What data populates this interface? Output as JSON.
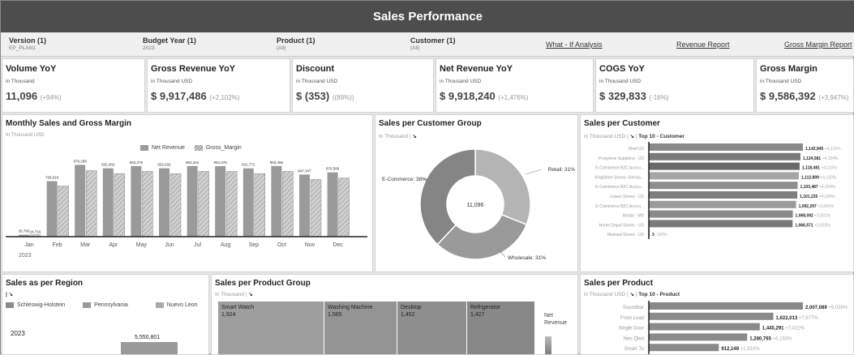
{
  "header": {
    "title": "Sales Performance"
  },
  "filters": [
    {
      "label": "Version (1)",
      "value": "EP_PLAN1"
    },
    {
      "label": "Budget Year (1)",
      "value": "2023"
    },
    {
      "label": "Product (1)",
      "value": "(All)"
    },
    {
      "label": "Customer (1)",
      "value": "(All)"
    }
  ],
  "links": {
    "what_if": "What - If  Analysis",
    "revenue": "Revenue Report",
    "gross_margin": "Gross Margin Report"
  },
  "kpis": [
    {
      "title": "Volume YoY",
      "unit": "in Thousand",
      "value": "11,096",
      "change": "(+94%)"
    },
    {
      "title": "Gross Revenue YoY",
      "unit": "in Thousand USD",
      "value": "$ 9,917,486",
      "change": "(+2,102%)"
    },
    {
      "title": "Discount",
      "unit": "in Thousand USD",
      "value": "$ (353)",
      "change": "((89%))"
    },
    {
      "title": "Net Revenue YoY",
      "unit": "in Thousand USD",
      "value": "$ 9,918,240",
      "change": "(+1,476%)"
    },
    {
      "title": "COGS YoY",
      "unit": "in Thousand USD",
      "value": "$ 329,833",
      "change": "(-16%)"
    },
    {
      "title": "Gross Margin",
      "unit": "in Thousand USD",
      "value": "$ 9,586,392",
      "change": "(+3,947%)"
    }
  ],
  "monthly": {
    "title": "Monthly Sales and Gross Margin",
    "unit": "In Thousand USD",
    "legend": [
      "Net Revenue",
      "Gross_Margin"
    ],
    "year": "2023",
    "colors": {
      "net": "#9a9a9a",
      "gm": "#c8c8c8"
    }
  },
  "customer_group": {
    "title": "Sales per Customer Group",
    "unit": "In Thousand",
    "center": "11,096",
    "labels": {
      "retail": "Retail: 31%",
      "ecommerce": "E-Commerce: 38%",
      "wholesale": "Wholesale: 31%"
    }
  },
  "sales_customer": {
    "title": "Sales per Customer",
    "unit": "in Thousand USD",
    "subtitle": "Top 10 - Customer"
  },
  "region": {
    "title": "Sales as per Region",
    "legend": [
      "Schleswig-Holstein",
      "Pennsylvania",
      "Nuevo Leon"
    ],
    "year": "2023",
    "value": "5,550,801"
  },
  "product_group": {
    "title": "Sales per Product Group",
    "unit": "In Thousand",
    "cells": [
      {
        "name": "Smart Watch",
        "value": "1,924"
      },
      {
        "name": "Washing Machine",
        "value": "1,565"
      },
      {
        "name": "Desktop",
        "value": "1,452"
      },
      {
        "name": "Refrigerator",
        "value": "1,427"
      }
    ],
    "legend": "Net Revenue"
  },
  "sales_product": {
    "title": "Sales per Product",
    "unit": "in Thousand USD",
    "subtitle": "Top 10 - Product"
  },
  "chart_data": [
    {
      "type": "bar",
      "title": "Monthly Sales and Gross Margin",
      "categories": [
        "Jan",
        "Feb",
        "Mar",
        "Apr",
        "May",
        "Jun",
        "Jul",
        "Aug",
        "Sep",
        "Oct",
        "Nov",
        "Dec"
      ],
      "series": [
        {
          "name": "Net Revenue",
          "values": [
            26766,
            756616,
            979299,
            932402,
            963278,
            932632,
            963344,
            962376,
            931771,
            963496,
            847347,
            876588
          ]
        },
        {
          "name": "Gross_Margin",
          "values": [
            24716,
            690000,
            900000,
            860000,
            890000,
            860000,
            890000,
            890000,
            860000,
            890000,
            780000,
            800000
          ]
        }
      ],
      "labels": [
        "26,766",
        "756,616",
        "979,299",
        "932,402",
        "963,278",
        "932,632",
        "963,344",
        "962,376",
        "931,771",
        "963,496",
        "847,347",
        "876,588"
      ],
      "gm_first_label": "24,716",
      "ylim": [
        0,
        1050000
      ]
    },
    {
      "type": "pie",
      "title": "Sales per Customer Group",
      "categories": [
        "Retail",
        "Wholesale",
        "E-Commerce"
      ],
      "values": [
        31,
        31,
        38
      ]
    },
    {
      "type": "bar",
      "title": "Sales per Customer",
      "categories": [
        "Shell US",
        "Prepylene Suppliers · US",
        "E-Commerce B2C Accou...",
        "Kingfisher Stores ·Germa...",
        "E-Commerce B2C Accou...",
        "Lowes Stores · US",
        "E-Commerce B2C Accou...",
        "Bimbo · MX",
        "Home Depot Stores · US",
        "Walmart Stores · US"
      ],
      "values": [
        1142945,
        1124581,
        1118481,
        1112809,
        1103487,
        1101225,
        1092297,
        1068092,
        1066571,
        3
      ],
      "labels": [
        "1,142,945",
        "1,124,581",
        "1,118,481",
        "1,112,809",
        "1,103,487",
        "1,101,225",
        "1,092,297",
        "1,068,092",
        "1,066,571",
        "3"
      ],
      "changes": [
        "+4,216%",
        "+4,164%",
        "+4,110%",
        "+4,100%",
        "+4,069%",
        "+4,098%",
        "+3,965%",
        "+3,931%",
        "+3,925%",
        "-100%"
      ],
      "colors": [
        "#8a8a8a",
        "#7a7a7a",
        "#6a6a6a",
        "#a6a6a6",
        "#8e8e8e",
        "#7e7e7e",
        "#9a9a9a",
        "#8a8a8a",
        "#7a7a7a",
        "#666666"
      ]
    },
    {
      "type": "bar",
      "title": "Sales per Product",
      "categories": [
        "Soundbar",
        "Front Load",
        "Single Door",
        "Neo Qled",
        "Smart Tv"
      ],
      "values": [
        2007089,
        1622013,
        1445291,
        1280765,
        912149
      ],
      "labels": [
        "2,007,089",
        "1,622,013",
        "1,445,291",
        "1,280,765",
        "912,149"
      ],
      "changes": [
        "+9,038%",
        "+7,877%",
        "+7,422%",
        "+6,163%",
        "+1,910%"
      ]
    }
  ]
}
